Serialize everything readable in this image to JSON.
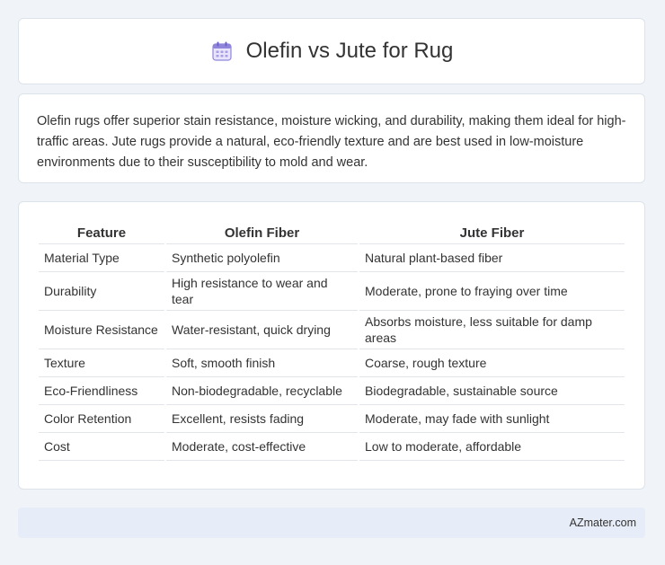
{
  "header": {
    "title": "Olefin vs Jute for Rug",
    "icon": "calendar-icon",
    "icon_color": "#7b6fd6"
  },
  "summary": {
    "text": "Olefin rugs offer superior stain resistance, moisture wicking, and durability, making them ideal for high-traffic areas. Jute rugs provide a natural, eco-friendly texture and are best used in low-moisture environments due to their susceptibility to mold and wear."
  },
  "table": {
    "headers": [
      "Feature",
      "Olefin Fiber",
      "Jute Fiber"
    ],
    "rows": [
      [
        "Material Type",
        "Synthetic polyolefin",
        "Natural plant-based fiber"
      ],
      [
        "Durability",
        "High resistance to wear and tear",
        "Moderate, prone to fraying over time"
      ],
      [
        "Moisture Resistance",
        "Water-resistant, quick drying",
        "Absorbs moisture, less suitable for damp areas"
      ],
      [
        "Texture",
        "Soft, smooth finish",
        "Coarse, rough texture"
      ],
      [
        "Eco-Friendliness",
        "Non-biodegradable, recyclable",
        "Biodegradable, sustainable source"
      ],
      [
        "Color Retention",
        "Excellent, resists fading",
        "Moderate, may fade with sunlight"
      ],
      [
        "Cost",
        "Moderate, cost-effective",
        "Low to moderate, affordable"
      ]
    ]
  },
  "footer": {
    "brand": "AZmater.com"
  }
}
